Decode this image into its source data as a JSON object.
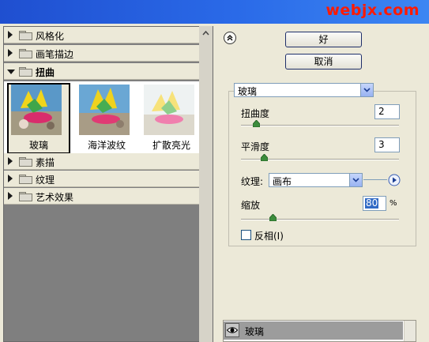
{
  "watermark": "webjx.com",
  "categories": [
    {
      "label": "风格化",
      "expanded": false
    },
    {
      "label": "画笔描边",
      "expanded": false
    },
    {
      "label": "扭曲",
      "expanded": true
    },
    {
      "label": "素描",
      "expanded": false
    },
    {
      "label": "纹理",
      "expanded": false
    },
    {
      "label": "艺术效果",
      "expanded": false
    }
  ],
  "thumbnails": [
    {
      "label": "玻璃",
      "selected": true
    },
    {
      "label": "海洋波纹",
      "selected": false
    },
    {
      "label": "扩散亮光",
      "selected": false
    }
  ],
  "buttons": {
    "ok": "好",
    "cancel": "取消"
  },
  "filter": {
    "selected": "玻璃"
  },
  "params": {
    "distortion": {
      "label": "扭曲度",
      "value": "2",
      "fraction": 0.1
    },
    "smoothness": {
      "label": "平滑度",
      "value": "3",
      "fraction": 0.2
    },
    "texture": {
      "label": "纹理:",
      "value": "画布"
    },
    "scaling": {
      "label": "缩放",
      "value": "80",
      "unit": "%",
      "fraction": 0.2
    },
    "invert": {
      "label": "反相(I)",
      "checked": false
    }
  },
  "layers": [
    {
      "label": "玻璃",
      "visible": true
    }
  ],
  "icons": {
    "collapse": "double-chevron-up-icon",
    "folder": "folder-icon",
    "dropdown": "chevron-down-icon",
    "menu": "triangle-right-icon",
    "eye": "eye-icon"
  },
  "colors": {
    "watermark": "#ff1a00",
    "selection": "#316ac5",
    "titlebar": "#2a6ae8"
  }
}
